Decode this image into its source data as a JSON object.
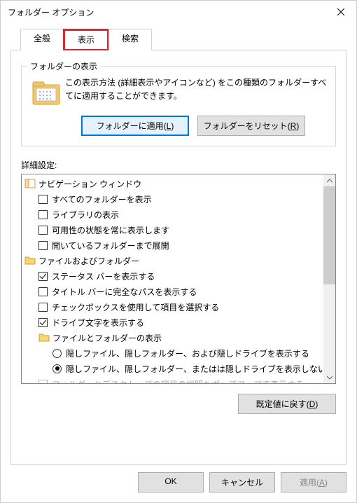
{
  "window": {
    "title": "フォルダー オプション"
  },
  "tabs": {
    "general": "全般",
    "view": "表示",
    "search": "検索",
    "active": "view"
  },
  "folderViews": {
    "groupTitle": "フォルダーの表示",
    "desc": "この表示方法 (詳細表示やアイコンなど) をこの種類のフォルダーすべてに適用することができます。",
    "applyBtn": "フォルダーに適用(L)",
    "resetBtn": "フォルダーをリセット(R)"
  },
  "advanced": {
    "label": "詳細設定:",
    "items": [
      {
        "type": "header",
        "icon": "nav",
        "indent": 0,
        "label": "ナビゲーション ウィンドウ"
      },
      {
        "type": "check",
        "checked": false,
        "indent": 1,
        "label": "すべてのフォルダーを表示"
      },
      {
        "type": "check",
        "checked": false,
        "indent": 1,
        "label": "ライブラリの表示"
      },
      {
        "type": "check",
        "checked": false,
        "indent": 1,
        "label": "可用性の状態を常に表示します"
      },
      {
        "type": "check",
        "checked": false,
        "indent": 1,
        "label": "開いているフォルダーまで展開"
      },
      {
        "type": "header",
        "icon": "folder",
        "indent": 0,
        "label": "ファイルおよびフォルダー"
      },
      {
        "type": "check",
        "checked": true,
        "indent": 1,
        "label": "ステータス バーを表示する"
      },
      {
        "type": "check",
        "checked": false,
        "indent": 1,
        "label": "タイトル バーに完全なパスを表示する"
      },
      {
        "type": "check",
        "checked": false,
        "indent": 1,
        "label": "チェックボックスを使用して項目を選択する"
      },
      {
        "type": "check",
        "checked": true,
        "indent": 1,
        "label": "ドライブ文字を表示する"
      },
      {
        "type": "header",
        "icon": "folder",
        "indent": 1,
        "label": "ファイルとフォルダーの表示"
      },
      {
        "type": "radio",
        "checked": false,
        "indent": 2,
        "label": "隠しファイル、隠しフォルダー、および隠しドライブを表示する"
      },
      {
        "type": "radio",
        "checked": true,
        "indent": 2,
        "label": "隠しファイル、隠しフォルダー、またはは隠しドライブを表示しない"
      },
      {
        "type": "check",
        "checked": false,
        "indent": 1,
        "label": "フォルダーとデスクトップの項目の説明をポップアップで表示する",
        "clipped": true
      }
    ]
  },
  "restoreDefaults": "既定値に戻す(D)",
  "footer": {
    "ok": "OK",
    "cancel": "キャンセル",
    "apply": "適用(A)"
  }
}
